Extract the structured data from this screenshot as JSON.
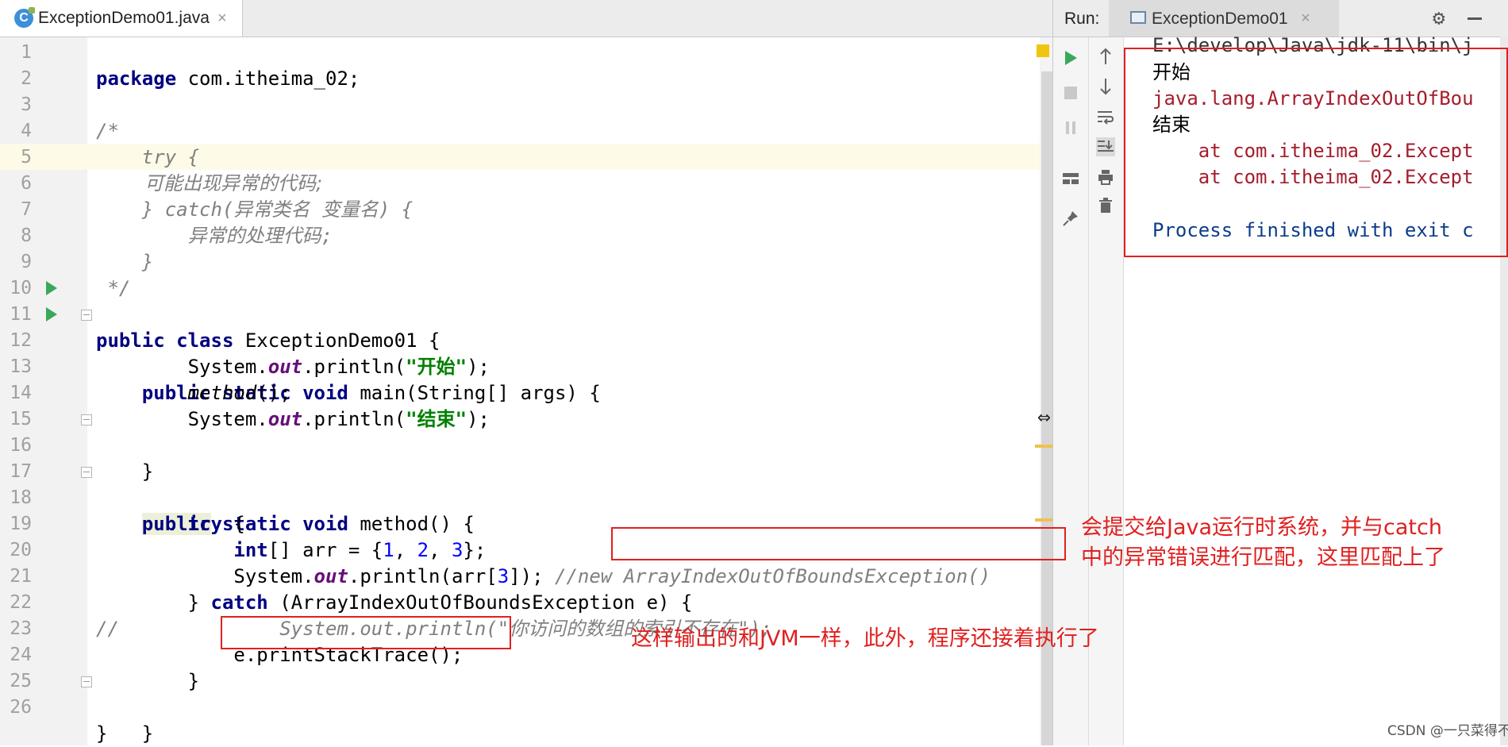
{
  "editor": {
    "tab_label": "ExceptionDemo01.java",
    "tab_close": "×",
    "tab_icon": "C",
    "lines": [
      {
        "n": "1"
      },
      {
        "n": "2"
      },
      {
        "n": "3"
      },
      {
        "n": "4"
      },
      {
        "n": "5"
      },
      {
        "n": "6"
      },
      {
        "n": "7"
      },
      {
        "n": "8"
      },
      {
        "n": "9"
      },
      {
        "n": "10"
      },
      {
        "n": "11"
      },
      {
        "n": "12"
      },
      {
        "n": "13"
      },
      {
        "n": "14"
      },
      {
        "n": "15"
      },
      {
        "n": "16"
      },
      {
        "n": "17"
      },
      {
        "n": "18"
      },
      {
        "n": "19"
      },
      {
        "n": "20"
      },
      {
        "n": "21"
      },
      {
        "n": "22"
      },
      {
        "n": "23"
      },
      {
        "n": "24"
      },
      {
        "n": "25"
      },
      {
        "n": "26"
      }
    ],
    "code": {
      "l1_kw": "package",
      "l1_rest": " com.itheima_02;",
      "l3": "/*",
      "l4": "    try {",
      "l5": "        可能出现异常的代码;",
      "l6": "    } catch(异常类名 变量名) {",
      "l7": "        异常的处理代码;",
      "l8": "    }",
      "l9": " */",
      "l10_kw": "public class",
      "l10_rest": " ExceptionDemo01 {",
      "l11_kw": "public static void",
      "l11_rest": " main(String[] args) {",
      "l12_a": "System.",
      "l12_fld": "out",
      "l12_b": ".println(",
      "l12_str": "\"开始\"",
      "l12_c": ");",
      "l13_it": "method",
      "l13_rest": "();",
      "l14_a": "System.",
      "l14_fld": "out",
      "l14_b": ".println(",
      "l14_str": "\"结束\"",
      "l14_c": ");",
      "l15": "}",
      "l17_kw1": "public",
      "l17_kw2": " static void",
      "l17_rest": " method() {",
      "l18_kw": "try",
      "l18_rest": " {",
      "l19_kw": "int",
      "l19_a": "[] arr = {",
      "l19_n1": "1",
      "l19_s1": ", ",
      "l19_n2": "2",
      "l19_s2": ", ",
      "l19_n3": "3",
      "l19_b": "};",
      "l20_a": "System.",
      "l20_fld": "out",
      "l20_b": ".println(arr[",
      "l20_n": "3",
      "l20_c": "]); ",
      "l20_cm": "//new ArrayIndexOutOfBoundsException()",
      "l21_a": "} ",
      "l21_kw": "catch",
      "l21_rest": " (ArrayIndexOutOfBoundsException e) {",
      "l22_cm1": "//",
      "l22_cm2": "System.out.println(\"你访问的数组的索引不存在\");",
      "l23": "e.printStackTrace();",
      "l24": "}",
      "l25": "}",
      "l26": "}"
    }
  },
  "run": {
    "title": "Run:",
    "tab_label": "ExceptionDemo01",
    "tab_close": "×",
    "console": {
      "l1": "E:\\develop\\Java\\jdk-11\\bin\\j",
      "l2": "开始",
      "l3": "java.lang.ArrayIndexOutOfBou",
      "l4": "结束",
      "l5": "    at com.itheima_02.Except",
      "l6": "    at com.itheima_02.Except",
      "l8": "Process finished with exit c"
    }
  },
  "annotations": {
    "right_note": "会提交给Java运行时系统，并与catch\n中的异常错误进行匹配，这里匹配上了",
    "bottom_note": "这样输出的和JVM一样，此外，程序还接着执行了"
  },
  "watermark": "CSDN @一只菜得不行的鸟",
  "icons": [
    "run-icon",
    "stop-icon",
    "pause-icon",
    "up-arrow-icon",
    "down-arrow-icon",
    "wrap-icon",
    "scroll-end-icon",
    "print-icon",
    "trash-icon",
    "pin-icon",
    "layout-icon",
    "gear-icon",
    "minimize-icon"
  ]
}
